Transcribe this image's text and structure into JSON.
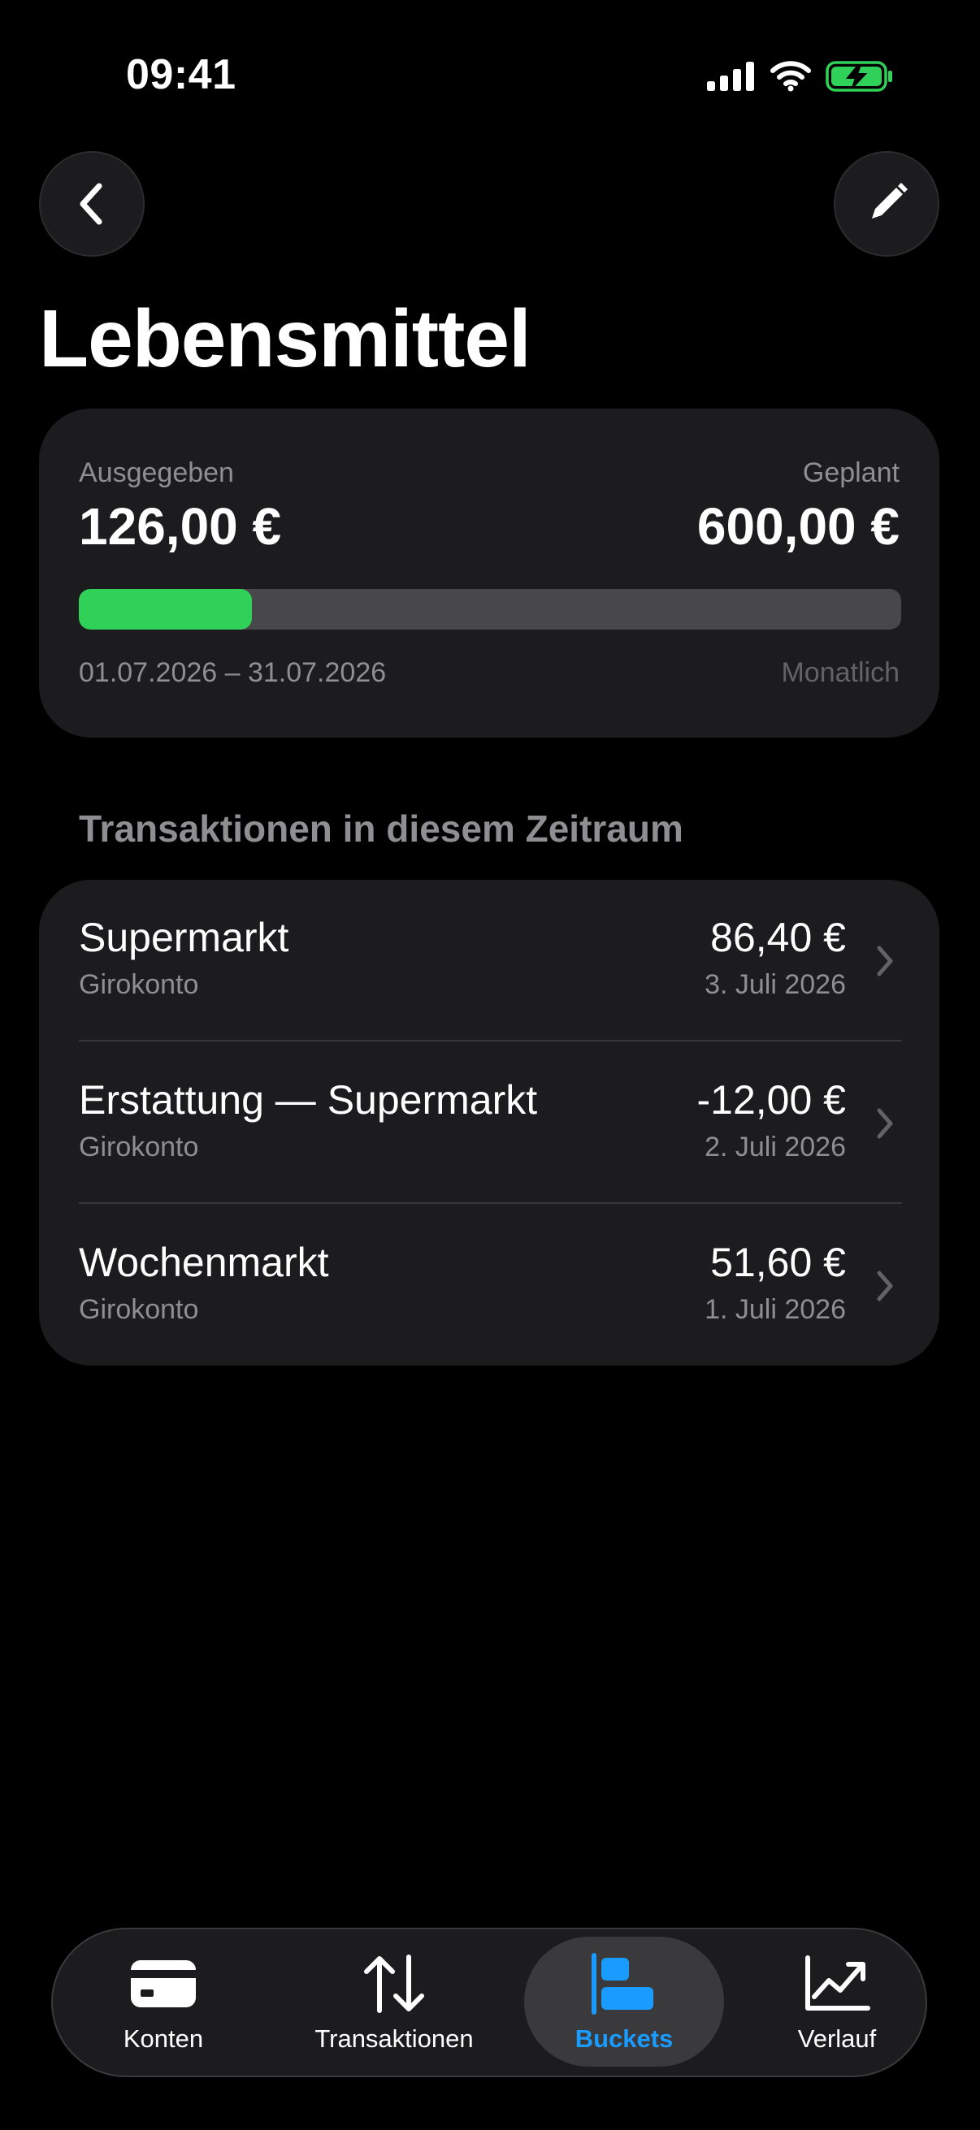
{
  "status_bar": {
    "time": "09:41"
  },
  "header": {
    "back_icon": "chevron-left-icon",
    "edit_icon": "pencil-icon",
    "title": "Lebensmittel"
  },
  "summary": {
    "spent_label": "Ausgegeben",
    "spent_amount": "126,00 €",
    "planned_label": "Geplant",
    "planned_amount": "600,00 €",
    "progress_fraction": 0.21,
    "progress_color": "#30d158",
    "period": "01.07.2026 – 31.07.2026",
    "frequency": "Monatlich"
  },
  "transactions": {
    "section_title": "Transaktionen in diesem Zeitraum",
    "items": [
      {
        "name": "Supermarkt",
        "account": "Girokonto",
        "amount": "86,40 €",
        "date": "3. Juli 2026"
      },
      {
        "name": "Erstattung — Supermarkt",
        "account": "Girokonto",
        "amount": "-12,00 €",
        "date": "2. Juli 2026"
      },
      {
        "name": "Wochenmarkt",
        "account": "Girokonto",
        "amount": "51,60 €",
        "date": "1. Juli 2026"
      }
    ]
  },
  "tab_bar": {
    "active_color": "#1a9bff",
    "tabs": [
      {
        "label": "Konten",
        "icon": "card-icon"
      },
      {
        "label": "Transaktionen",
        "icon": "arrows-up-down-icon"
      },
      {
        "label": "Buckets",
        "icon": "buckets-icon",
        "active": true
      },
      {
        "label": "Verlauf",
        "icon": "chart-line-icon"
      }
    ]
  }
}
